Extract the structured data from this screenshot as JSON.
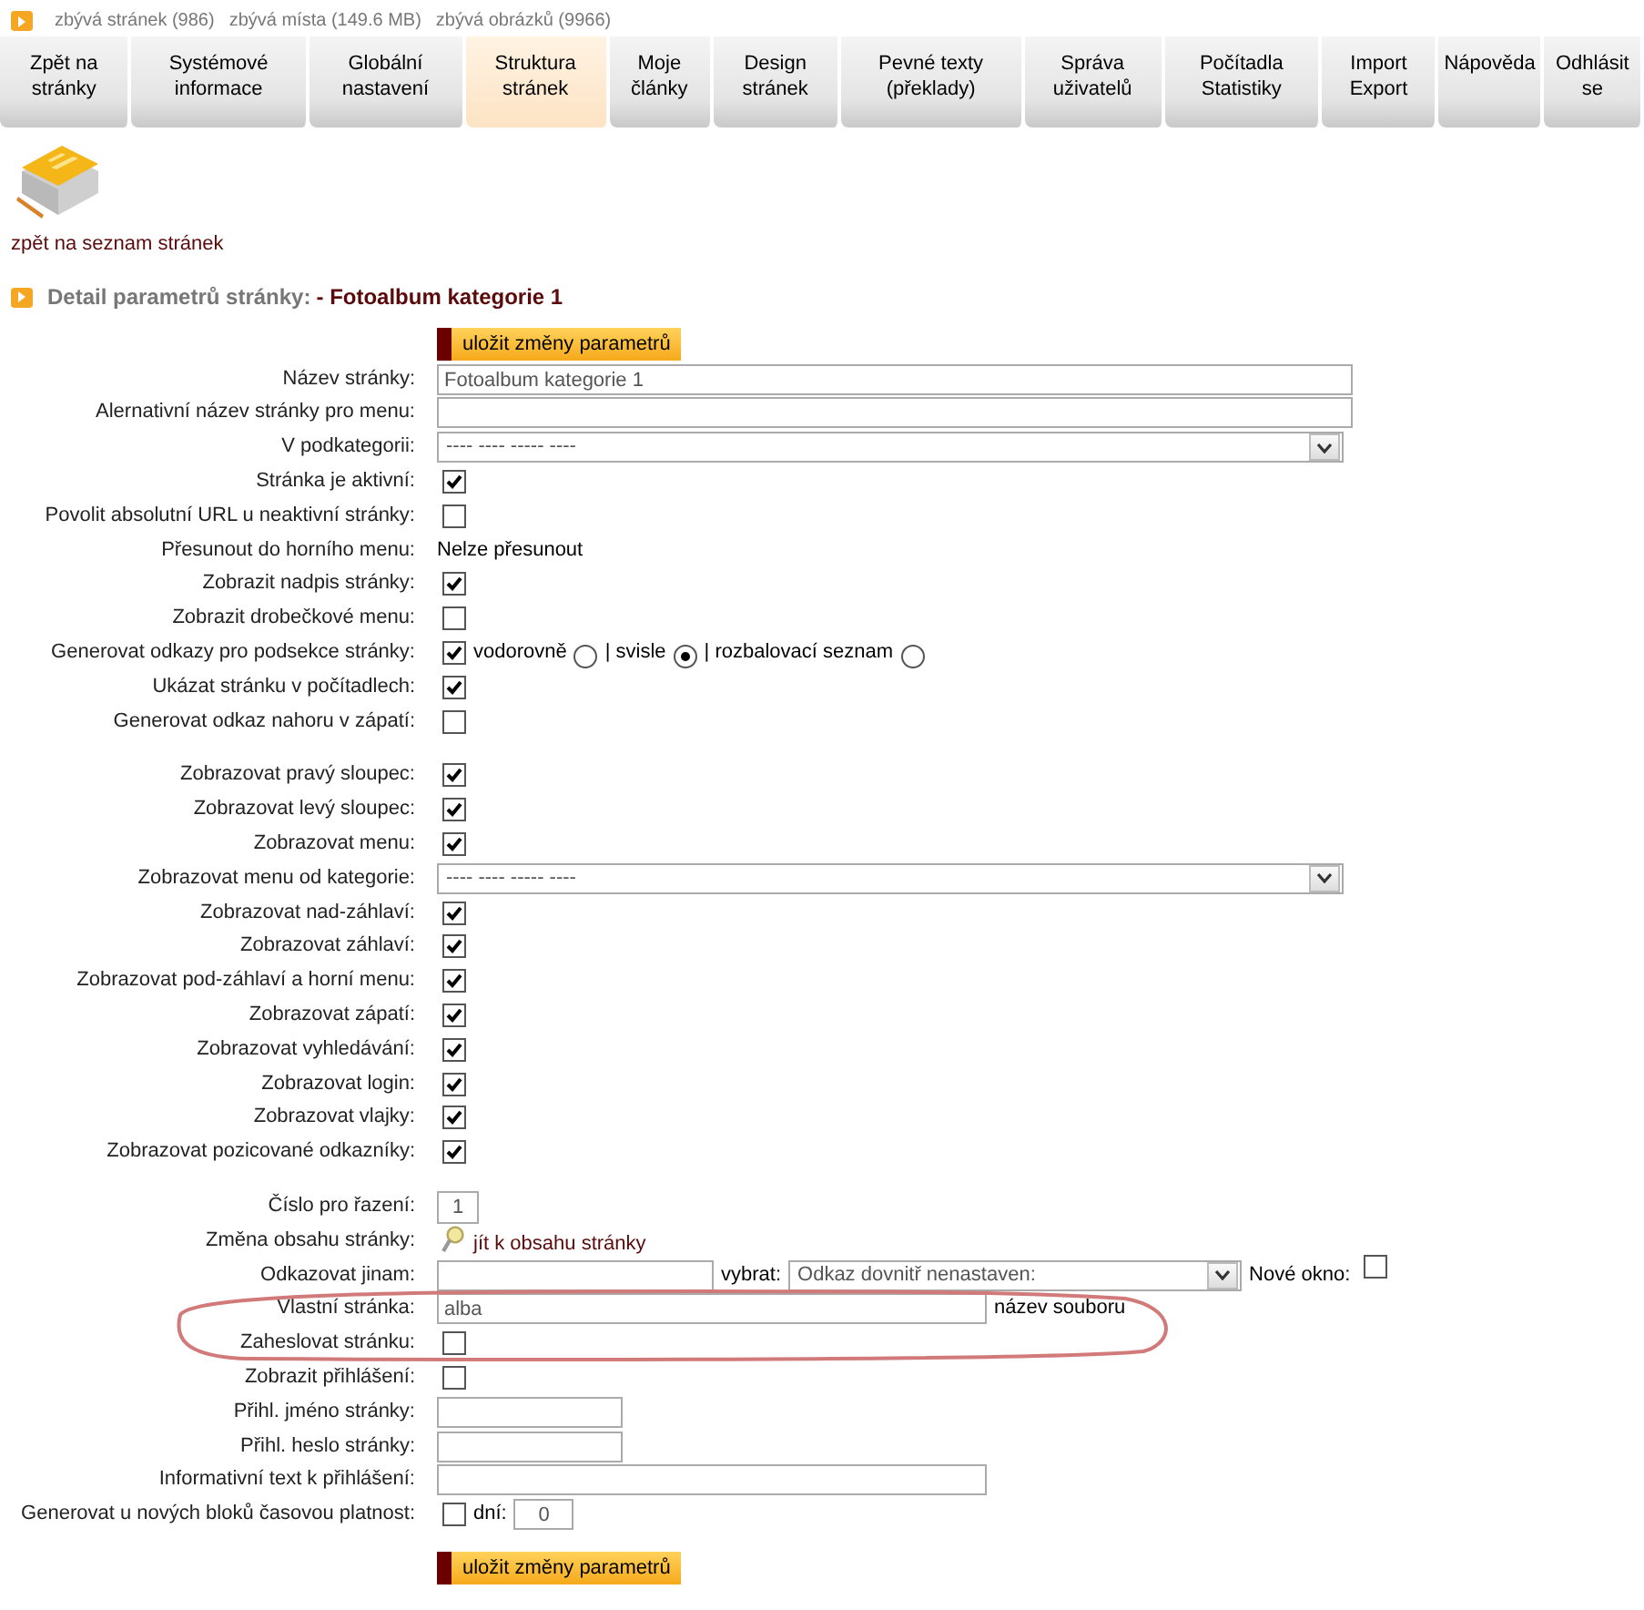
{
  "quota": [
    "zbývá stránek (986)",
    "zbývá místa (149.6 MB)",
    "zbývá obrázků (9966)"
  ],
  "tabs": [
    {
      "label": "Zpět na stránky",
      "selected": false
    },
    {
      "label": "Systémové informace",
      "selected": false
    },
    {
      "label": "Globální nastavení",
      "selected": false
    },
    {
      "label": "Struktura stránek",
      "selected": true
    },
    {
      "label": "Moje články",
      "selected": false
    },
    {
      "label": "Design stránek",
      "selected": false
    },
    {
      "label": "Pevné texty (překlady)",
      "selected": false
    },
    {
      "label": "Správa uživatelů",
      "selected": false
    },
    {
      "label": "Počítadla Statistiky",
      "selected": false
    },
    {
      "label": "Import Export",
      "selected": false
    },
    {
      "label": "Nápověda",
      "selected": false
    },
    {
      "label": "Odhlásit se",
      "selected": false
    }
  ],
  "back_link": "zpět na seznam stránek",
  "heading": {
    "label": "Detail parametrů stránky:",
    "page": "- Fotoalbum kategorie 1"
  },
  "save_button": "uložit změny parametrů",
  "sections": [
    [
      {
        "kind": "text",
        "label": "Název stránky:",
        "value": "Fotoalbum kategorie 1"
      },
      {
        "kind": "text",
        "label": "Alernativní název stránky pro menu:"
      },
      {
        "kind": "select",
        "label": "V podkategorii:",
        "value": "---- ---- ----- ----"
      },
      {
        "kind": "checkbox",
        "label": "Stránka je aktivní:",
        "checked": true
      },
      {
        "kind": "checkbox",
        "label": "Povolit absolutní URL u neaktivní stránky:",
        "checked": false
      },
      {
        "kind": "static",
        "label": "Přesunout do horního menu:",
        "value": "Nelze přesunout"
      },
      {
        "kind": "checkbox",
        "label": "Zobrazit nadpis stránky:",
        "checked": true
      },
      {
        "kind": "checkbox",
        "label": "Zobrazit drobečkové menu:",
        "checked": false
      },
      {
        "kind": "radios",
        "label": "Generovat odkazy pro podsekce stránky:",
        "checked": true,
        "options": [
          {
            "label": "vodorovně",
            "selected": false
          },
          {
            "label": "| svisle",
            "selected": true
          },
          {
            "label": "| rozbalovací seznam",
            "selected": false
          }
        ]
      },
      {
        "kind": "checkbox",
        "label": "Ukázat stránku v počítadlech:",
        "checked": true
      },
      {
        "kind": "checkbox",
        "label": "Generovat odkaz nahoru v zápatí:",
        "checked": false
      }
    ],
    [
      {
        "kind": "checkbox",
        "label": "Zobrazovat pravý sloupec:",
        "checked": true
      },
      {
        "kind": "checkbox",
        "label": "Zobrazovat levý sloupec:",
        "checked": true
      },
      {
        "kind": "checkbox",
        "label": "Zobrazovat menu:",
        "checked": true
      },
      {
        "kind": "select",
        "label": "Zobrazovat menu od kategorie:",
        "value": "---- ---- ----- ----"
      },
      {
        "kind": "checkbox",
        "label": "Zobrazovat nad-záhlaví:",
        "checked": true
      },
      {
        "kind": "checkbox",
        "label": "Zobrazovat záhlaví:",
        "checked": true
      },
      {
        "kind": "checkbox",
        "label": "Zobrazovat pod-záhlaví a horní menu:",
        "checked": true
      },
      {
        "kind": "checkbox",
        "label": "Zobrazovat zápatí:",
        "checked": true
      },
      {
        "kind": "checkbox",
        "label": "Zobrazovat vyhledávání:",
        "checked": true
      },
      {
        "kind": "checkbox",
        "label": "Zobrazovat login:",
        "checked": true
      },
      {
        "kind": "checkbox",
        "label": "Zobrazovat vlajky:",
        "checked": true
      },
      {
        "kind": "checkbox",
        "label": "Zobrazovat pozicované odkazníky:",
        "checked": true
      }
    ],
    [
      {
        "kind": "number",
        "label": "Číslo pro řazení:",
        "value": "1"
      },
      {
        "kind": "link",
        "label": "Změna obsahu stránky:",
        "value": "jít k obsahu stránky"
      },
      {
        "kind": "redirect",
        "label": "Odkazovat jinam:",
        "select_label": "vybrat:",
        "select_value": "Odkaz dovnitř nenastaven:",
        "window_label": "Nové okno:",
        "window_checked": false
      },
      {
        "kind": "file",
        "label": "Vlastní stránka:",
        "value": "alba",
        "note": "název souboru"
      },
      {
        "kind": "checkbox",
        "label": "Zaheslovat stránku:",
        "checked": false
      },
      {
        "kind": "checkbox",
        "label": "Zobrazit přihlášení:",
        "checked": false
      },
      {
        "kind": "short_text",
        "label": "Přihl. jméno stránky:"
      },
      {
        "kind": "short_text",
        "label": "Přihl. heslo stránky:"
      },
      {
        "kind": "medium_text",
        "label": "Informativní text k přihlášení:"
      },
      {
        "kind": "days",
        "label": "Generovat u nových bloků časovou platnost:",
        "checked": false,
        "unit": "dní:",
        "value": "0"
      }
    ]
  ],
  "save_button_bottom": "uložit změny parametrů"
}
